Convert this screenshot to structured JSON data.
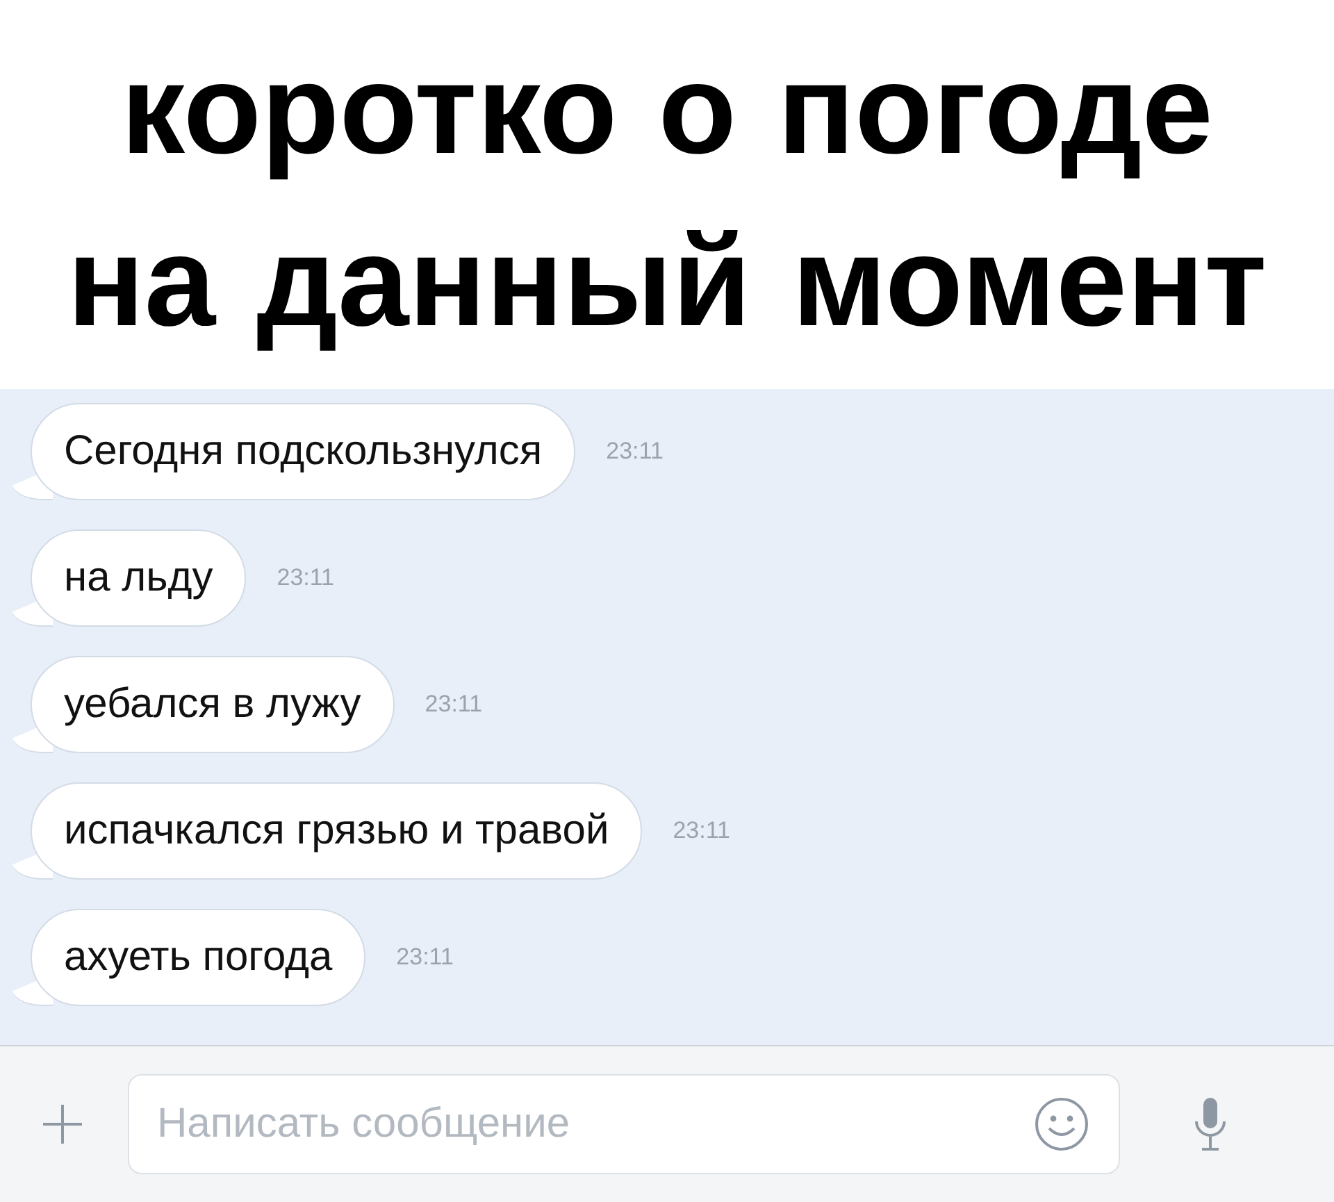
{
  "caption": [
    "коротко о погоде",
    "на данный момент"
  ],
  "messages": [
    {
      "text": "Сегодня подскользнулся",
      "time": "23:11"
    },
    {
      "text": "на льду",
      "time": "23:11"
    },
    {
      "text": "уебался в лужу",
      "time": "23:11"
    },
    {
      "text": "испачкался грязью и травой",
      "time": "23:11"
    },
    {
      "text": "ахуеть погода",
      "time": "23:11"
    }
  ],
  "composer": {
    "placeholder": "Написать сообщение"
  }
}
